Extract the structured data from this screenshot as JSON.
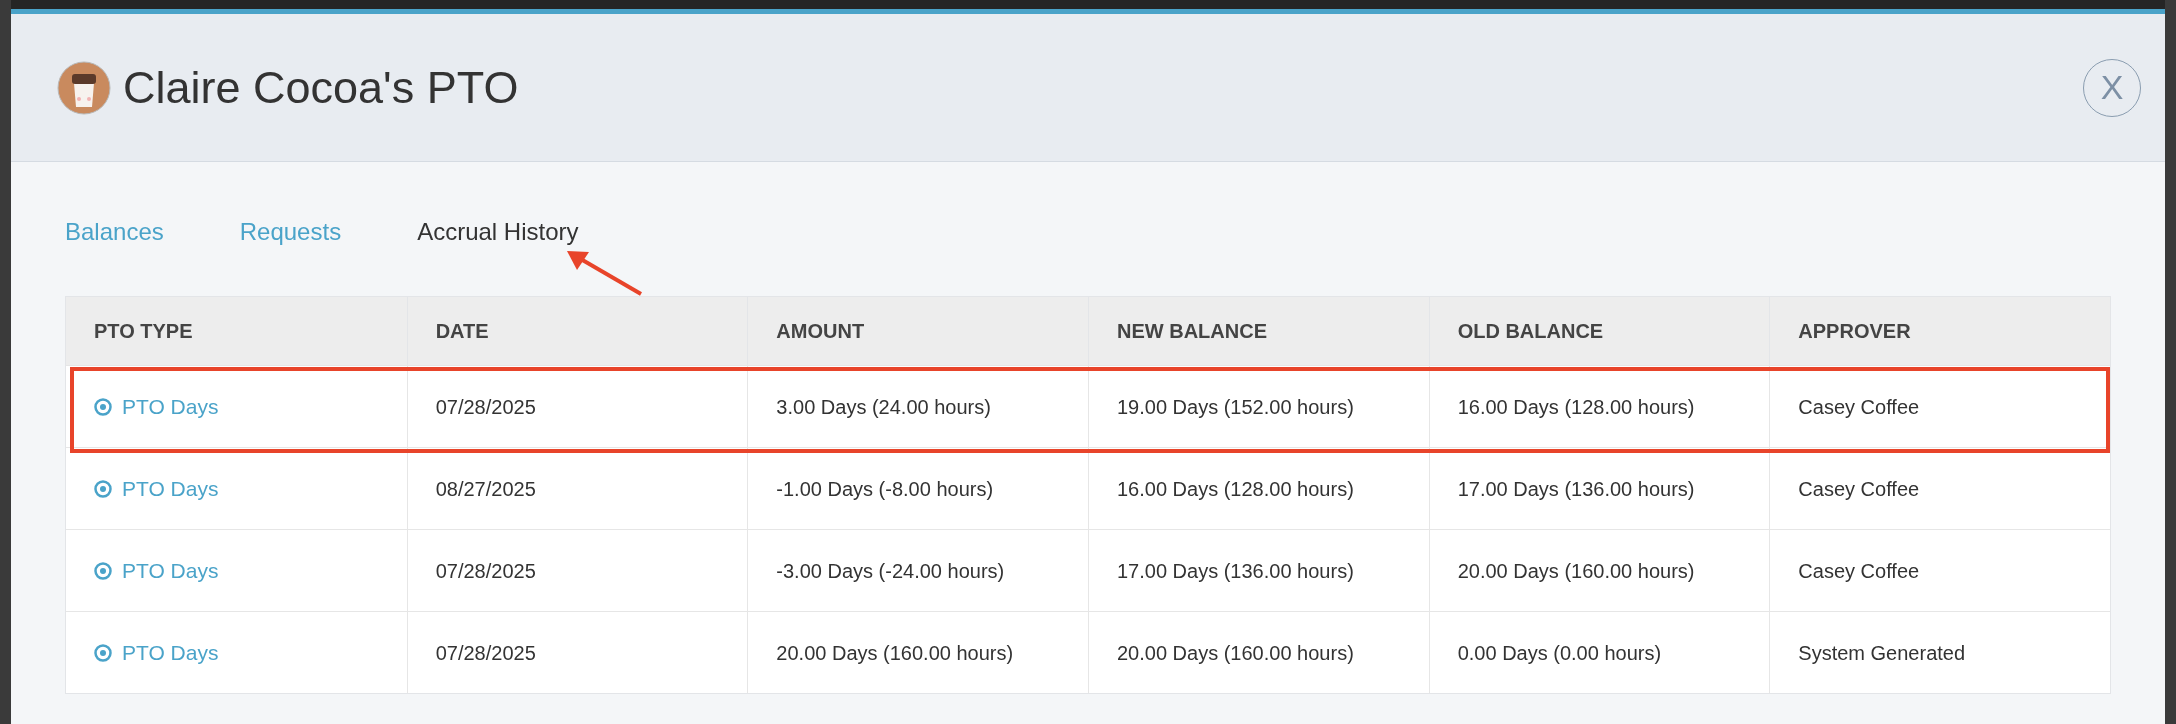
{
  "modal": {
    "title": "Claire Cocoa's PTO",
    "close_label": "X"
  },
  "tabs": [
    {
      "label": "Balances",
      "selected": false
    },
    {
      "label": "Requests",
      "selected": false
    },
    {
      "label": "Accrual History",
      "selected": true
    }
  ],
  "table": {
    "columns": [
      "PTO TYPE",
      "DATE",
      "AMOUNT",
      "NEW BALANCE",
      "OLD BALANCE",
      "APPROVER"
    ],
    "rows": [
      {
        "pto_type": "PTO Days",
        "date": "07/28/2025",
        "amount": "3.00 Days (24.00 hours)",
        "new_balance": "19.00 Days (152.00 hours)",
        "old_balance": "16.00 Days (128.00 hours)",
        "approver": "Casey Coffee",
        "highlighted": true
      },
      {
        "pto_type": "PTO Days",
        "date": "08/27/2025",
        "amount": "-1.00 Days (-8.00 hours)",
        "new_balance": "16.00 Days (128.00 hours)",
        "old_balance": "17.00 Days (136.00 hours)",
        "approver": "Casey Coffee",
        "highlighted": false
      },
      {
        "pto_type": "PTO Days",
        "date": "07/28/2025",
        "amount": "-3.00 Days (-24.00 hours)",
        "new_balance": "17.00 Days (136.00 hours)",
        "old_balance": "20.00 Days (160.00 hours)",
        "approver": "Casey Coffee",
        "highlighted": false
      },
      {
        "pto_type": "PTO Days",
        "date": "07/28/2025",
        "amount": "20.00 Days (160.00 hours)",
        "new_balance": "20.00 Days (160.00 hours)",
        "old_balance": "0.00 Days (0.00 hours)",
        "approver": "System Generated",
        "highlighted": false
      }
    ]
  }
}
